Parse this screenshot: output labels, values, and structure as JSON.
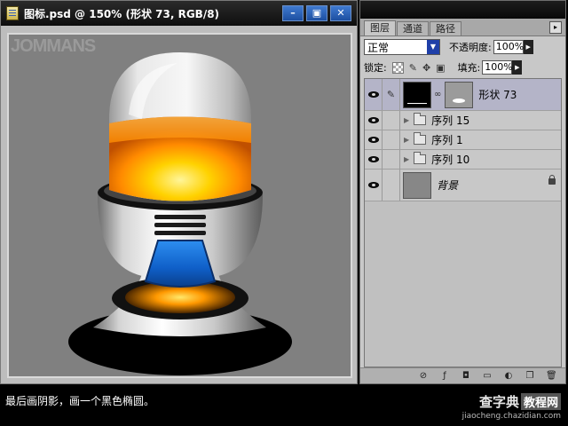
{
  "document": {
    "title": "图标.psd @ 150% (形状 73, RGB/8)",
    "watermark": "JOMMANS",
    "window_buttons": {
      "minimize": "–",
      "restore": "▣",
      "close": "✕"
    }
  },
  "layers_panel": {
    "tabs": [
      {
        "label": "图层"
      },
      {
        "label": "通道"
      },
      {
        "label": "路径"
      }
    ],
    "blend_mode": "正常",
    "opacity_label": "不透明度:",
    "opacity_value": "100%",
    "lock_label": "锁定:",
    "fill_label": "填充:",
    "fill_value": "100%",
    "layers": [
      {
        "name": "形状 73",
        "kind": "shape"
      },
      {
        "name": "序列 15",
        "kind": "group"
      },
      {
        "name": "序列 1",
        "kind": "group"
      },
      {
        "name": "序列 10",
        "kind": "group"
      },
      {
        "name": "背景",
        "kind": "background"
      }
    ]
  },
  "caption": "最后画阴影，画一个黑色椭圆。",
  "site": {
    "name_prefix": "查字典",
    "name_box": "教程网",
    "url": "jiaocheng.chazidian.com"
  },
  "colors": {
    "accent_blue": "#1f4fb0",
    "orange": "#ff9a00",
    "canvas_gray": "#808080"
  }
}
